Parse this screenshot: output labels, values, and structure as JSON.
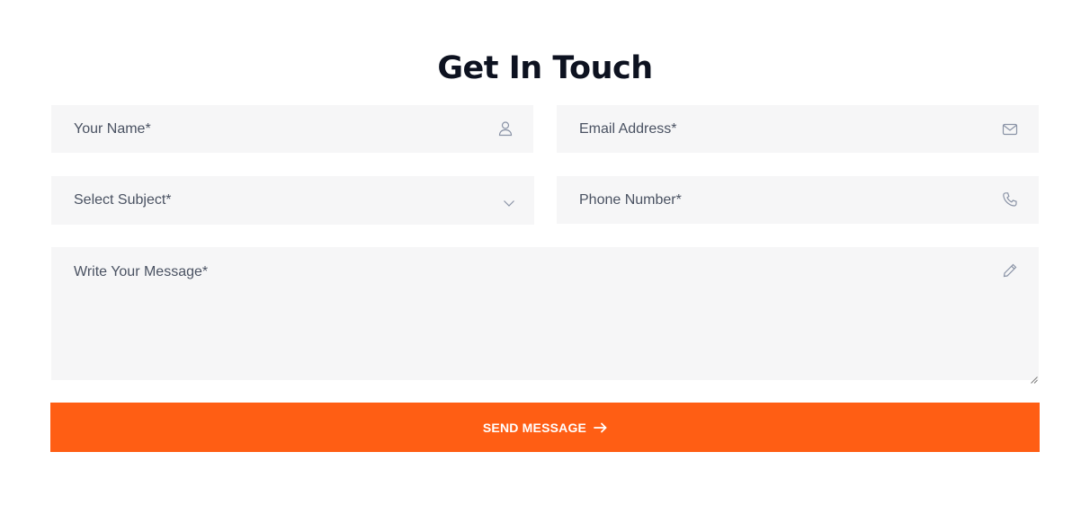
{
  "form": {
    "title": "Get In Touch",
    "name": {
      "placeholder": "Your Name*",
      "value": "",
      "icon": "user-icon"
    },
    "email": {
      "placeholder": "Email Address*",
      "value": "",
      "icon": "envelope-icon"
    },
    "subject": {
      "selected": "Select Subject*",
      "icon": "chevron-down-icon"
    },
    "phone": {
      "placeholder": "Phone Number*",
      "value": "",
      "icon": "phone-icon"
    },
    "message": {
      "placeholder": "Write Your Message*",
      "value": "",
      "icon": "pencil-icon"
    },
    "submit_label": "SEND MESSAGE",
    "submit_icon": "arrow-right-icon"
  },
  "colors": {
    "accent": "#ff5e14",
    "field_background": "#f6f6f7",
    "title": "#0d1220",
    "placeholder": "#4a5262",
    "icon": "#8a93a6"
  }
}
